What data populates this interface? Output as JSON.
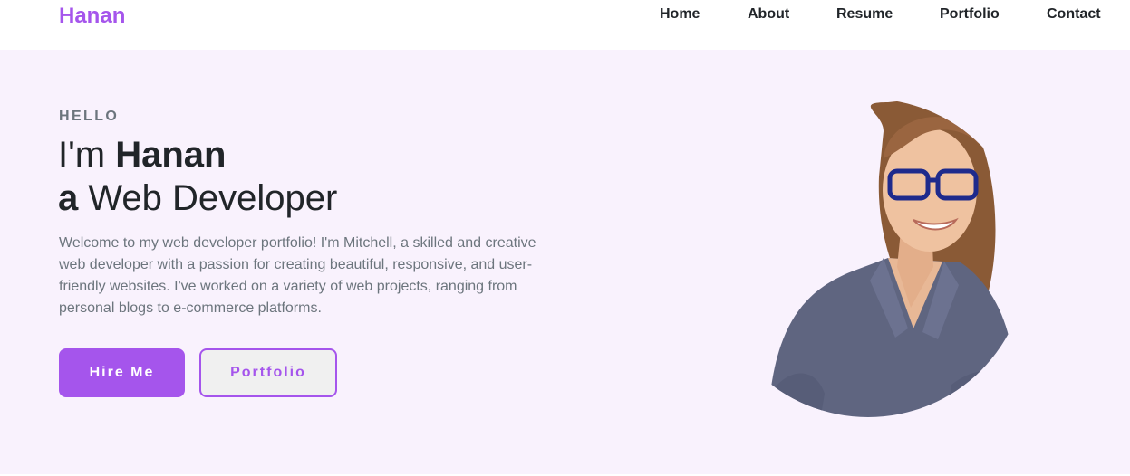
{
  "navbar": {
    "brand": "Hanan",
    "links": [
      "Home",
      "About",
      "Resume",
      "Portfolio",
      "Contact"
    ]
  },
  "hero": {
    "eyebrow": "HELLO",
    "line1_prefix": "I'm ",
    "line1_name": "Hanan",
    "line2_prefix": "a",
    "line2_role": " Web Developer",
    "intro": "Welcome to my web developer portfolio! I'm Mitchell, a skilled and creative web developer with a passion for creating beautiful, responsive, and user-friendly websites. I've worked on a variety of web projects, ranging from personal blogs to e-commerce platforms.",
    "primary_button": "Hire Me",
    "secondary_button": "Portfolio"
  },
  "colors": {
    "accent": "#a555ec",
    "hero_background": "#f9f2fd",
    "text_dark": "#212529",
    "text_muted": "#6c757d"
  }
}
